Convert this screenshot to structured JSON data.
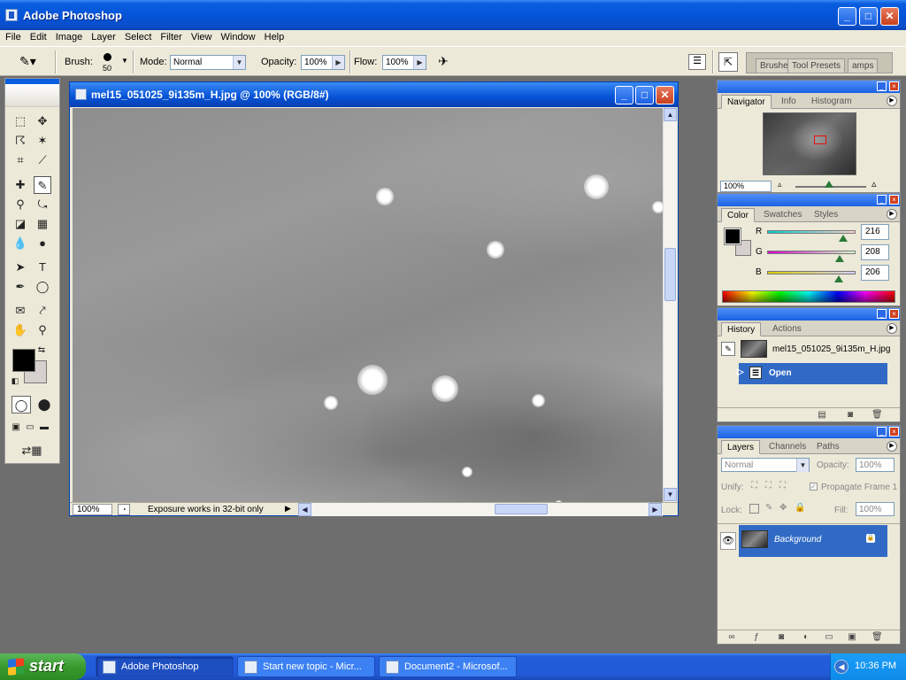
{
  "app": {
    "title": "Adobe Photoshop"
  },
  "menu": [
    "File",
    "Edit",
    "Image",
    "Layer",
    "Select",
    "Filter",
    "View",
    "Window",
    "Help"
  ],
  "options": {
    "brush_label": "Brush:",
    "brush_size": "50",
    "mode_label": "Mode:",
    "mode_value": "Normal",
    "opacity_label": "Opacity:",
    "opacity_value": "100%",
    "flow_label": "Flow:",
    "flow_value": "100%",
    "well_tabs": [
      "Brushe",
      "Tool Presets",
      "amps"
    ]
  },
  "document": {
    "title": "mel15_051025_9i135m_H.jpg @ 100% (RGB/8#)",
    "zoom": "100%",
    "status": "Exposure works in 32-bit only"
  },
  "navigator": {
    "tabs": [
      "Navigator",
      "Info",
      "Histogram"
    ],
    "zoom": "100%"
  },
  "color": {
    "tabs": [
      "Color",
      "Swatches",
      "Styles"
    ],
    "r_label": "R",
    "r_value": "216",
    "g_label": "G",
    "g_value": "208",
    "b_label": "B",
    "b_value": "206",
    "accents": {
      "foreground": "#000000",
      "background": "#d8d0ce"
    }
  },
  "history": {
    "tabs": [
      "History",
      "Actions"
    ],
    "snapshot": "mel15_051025_9i135m_H.jpg",
    "step": "Open"
  },
  "layers": {
    "tabs": [
      "Layers",
      "Channels",
      "Paths"
    ],
    "blend_mode": "Normal",
    "opacity_label": "Opacity:",
    "opacity_value": "100%",
    "unify_label": "Unify:",
    "propagate_label": "Propagate Frame 1",
    "lock_label": "Lock:",
    "fill_label": "Fill:",
    "fill_value": "100%",
    "layer_name": "Background"
  },
  "taskbar": {
    "start": "start",
    "tasks": [
      "Adobe Photoshop",
      "Start new topic - Micr...",
      "Document2 - Microsof..."
    ],
    "clock": "10:36 PM"
  }
}
